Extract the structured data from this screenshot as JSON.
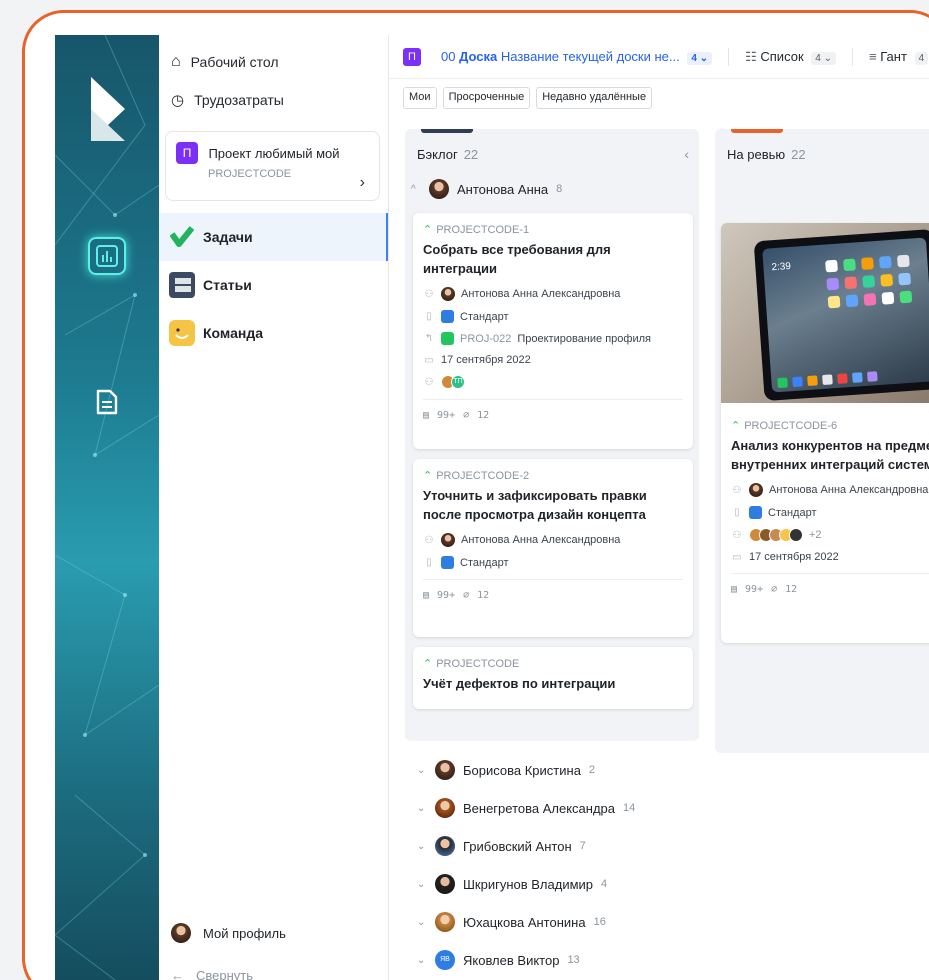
{
  "sidebar": {
    "desktop_label": "Рабочий стол",
    "timesheet_label": "Трудозатраты",
    "project": {
      "badge": "П",
      "name": "Проект любимый мой",
      "code": "PROJECTCODE",
      "chevron": "›"
    },
    "sections": [
      {
        "label": "Задачи",
        "icon": "check-icon"
      },
      {
        "label": "Статьи",
        "icon": "articles-icon"
      },
      {
        "label": "Команда",
        "icon": "smile-icon"
      }
    ],
    "profile_label": "Мой профиль",
    "collapse_label": "Свернуть",
    "collapse_arrow": "←"
  },
  "tabs": {
    "project_badge": "П",
    "board_icon": "00",
    "board_label": "Доска",
    "board_name": "Название текущей доски не...",
    "board_count": "4",
    "list_icon": "☷",
    "list_label": "Список",
    "list_count": "4",
    "gantt_icon": "≡",
    "gantt_label": "Гант",
    "gantt_count": "4",
    "dropdown": "⌄"
  },
  "filters": [
    "Мои",
    "Просроченные",
    "Недавно удалённые"
  ],
  "columns": [
    {
      "title": "Бэклог",
      "count": "22",
      "collapse": "‹",
      "accent": "#2f3e56"
    },
    {
      "title": "На ревью",
      "count": "22",
      "accent": "#e8622a"
    }
  ],
  "backlog": {
    "group": {
      "name": "Антонова Анна",
      "count": "8",
      "arrow": "^"
    },
    "cards": [
      {
        "code": "PROJECTCODE-1",
        "title": "Собрать все требования для интеграции",
        "assignee": "Антонова Анна Александровна",
        "type": "Стандарт",
        "parent_code": "PROJ-022",
        "parent_name": "Проектирование профиля",
        "date": "17 сентября 2022",
        "member_initials": "ТП",
        "comments": "99+",
        "attachments": "12"
      },
      {
        "code": "PROJECTCODE-2",
        "title": "Уточнить и зафиксировать правки после просмотра дизайн концепта",
        "assignee": "Антонова Анна Александровна",
        "type": "Стандарт",
        "comments": "99+",
        "attachments": "12"
      },
      {
        "code": "PROJECTCODE",
        "title": "Учёт дефектов по интеграции"
      }
    ],
    "other_groups": [
      {
        "name": "Борисова Кристина",
        "count": "2"
      },
      {
        "name": "Венегретова Александра",
        "count": "14"
      },
      {
        "name": "Грибовский Антон",
        "count": "7"
      },
      {
        "name": "Шкригунов Владимир",
        "count": "4"
      },
      {
        "name": "Юхацкова Антонина",
        "count": "16"
      },
      {
        "name": "Яковлев Виктор",
        "count": "13",
        "initials": "ЯВ"
      }
    ],
    "arrow_collapsed": "⌄"
  },
  "review": {
    "card": {
      "image_time": "2:39",
      "code": "PROJECTCODE-6",
      "title": "Анализ конкурентов на предмет внутренних интеграций систем",
      "assignee": "Антонова Анна Александровна",
      "type": "Стандарт",
      "members_more": "+2",
      "date": "17 сентября 2022",
      "comments": "99+",
      "attachments": "12"
    }
  }
}
